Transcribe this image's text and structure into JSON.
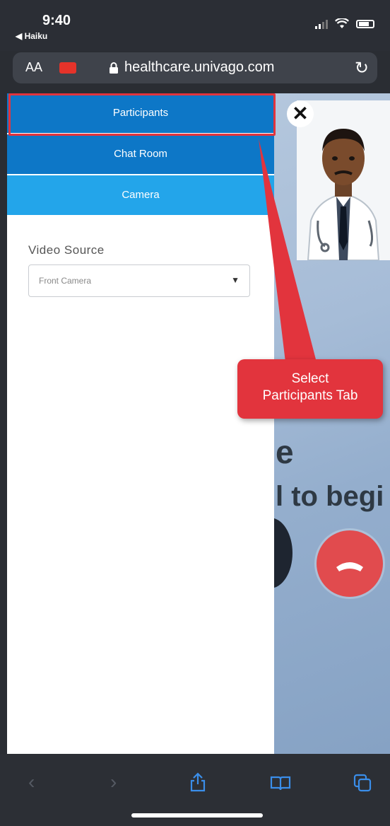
{
  "status_bar": {
    "time": "9:40",
    "back_app": "◀ Haiku"
  },
  "browser": {
    "text_size_label": "AA",
    "url": "healthcare.univago.com",
    "reload_icon": "reload-icon"
  },
  "sidebar": {
    "tabs": [
      {
        "label": "Participants"
      },
      {
        "label": "Chat Room"
      },
      {
        "label": "Camera"
      }
    ],
    "video_source_label": "Video Source",
    "video_source_value": "Front Camera"
  },
  "background": {
    "text_line1": "e",
    "text_line2": "l to begi"
  },
  "annotation": {
    "callout_line1": "Select",
    "callout_line2": "Participants Tab",
    "color": "#e2343d"
  },
  "colors": {
    "tab_active": "#0d77c7",
    "tab_camera": "#23a5ea",
    "hangup": "#e14b4e",
    "toolbar_icon": "#3a8eea"
  }
}
